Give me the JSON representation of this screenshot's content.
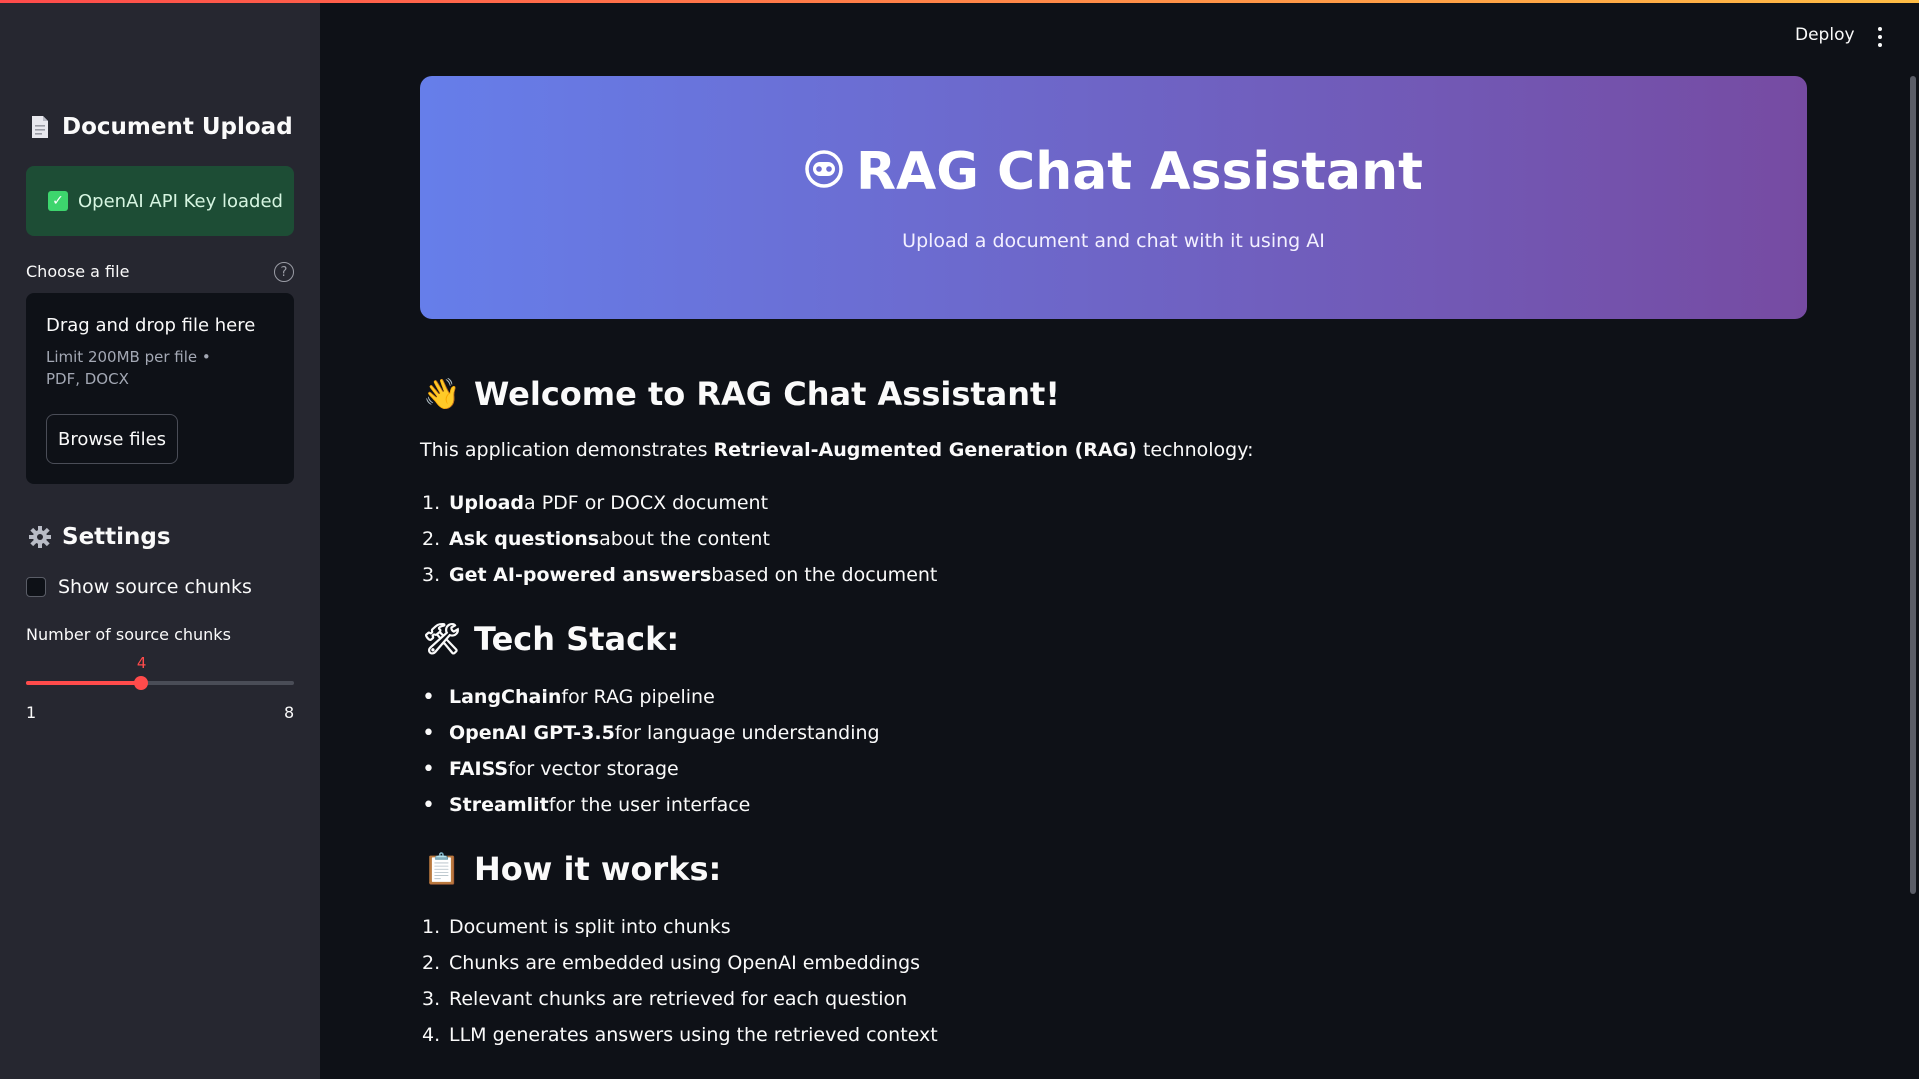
{
  "toolbar": {
    "deploy_label": "Deploy",
    "menu_icon": "kebab-menu-icon"
  },
  "sidebar": {
    "upload_title": "Document Upload",
    "upload_icon": "document-icon",
    "api_status": "OpenAI API Key loaded",
    "file_label": "Choose a file",
    "dropzone": {
      "title": "Drag and drop file here",
      "limit": "Limit 200MB per file • PDF, DOCX",
      "browse_label": "Browse files"
    },
    "settings_title": "Settings",
    "settings_icon": "gear-icon",
    "show_chunks_label": "Show source chunks",
    "show_chunks_checked": false,
    "slider": {
      "label": "Number of source chunks",
      "min": "1",
      "max": "8",
      "value": "4",
      "value_num": 4,
      "min_num": 1,
      "max_num": 8
    }
  },
  "hero": {
    "title": "RAG Chat Assistant",
    "subtitle": "Upload a document and chat with it using AI",
    "icon": "robot-icon"
  },
  "welcome": {
    "heading": "Welcome to RAG Chat Assistant!",
    "intro_prefix": "This application demonstrates ",
    "intro_bold": "Retrieval-Augmented Generation (RAG)",
    "intro_suffix": " technology:",
    "steps": [
      {
        "num": "1.",
        "bold": "Upload",
        "rest": " a PDF or DOCX document"
      },
      {
        "num": "2.",
        "bold": "Ask questions",
        "rest": " about the content"
      },
      {
        "num": "3.",
        "bold": "Get AI-powered answers",
        "rest": " based on the document"
      }
    ]
  },
  "tech": {
    "heading": "Tech Stack:",
    "items": [
      {
        "bold": "LangChain",
        "rest": " for RAG pipeline"
      },
      {
        "bold": "OpenAI GPT-3.5",
        "rest": " for language understanding"
      },
      {
        "bold": "FAISS",
        "rest": " for vector storage"
      },
      {
        "bold": "Streamlit",
        "rest": " for the user interface"
      }
    ]
  },
  "how": {
    "heading": "How it works:",
    "steps": [
      {
        "num": "1.",
        "text": "Document is split into chunks"
      },
      {
        "num": "2.",
        "text": "Chunks are embedded using OpenAI embeddings"
      },
      {
        "num": "3.",
        "text": "Relevant chunks are retrieved for each question"
      },
      {
        "num": "4.",
        "text": "LLM generates answers using the retrieved context"
      }
    ]
  },
  "colors": {
    "accent": "#ff4b4b",
    "hero_start": "#667eea",
    "hero_end": "#764ba2",
    "success_bg": "#1d4d35"
  }
}
